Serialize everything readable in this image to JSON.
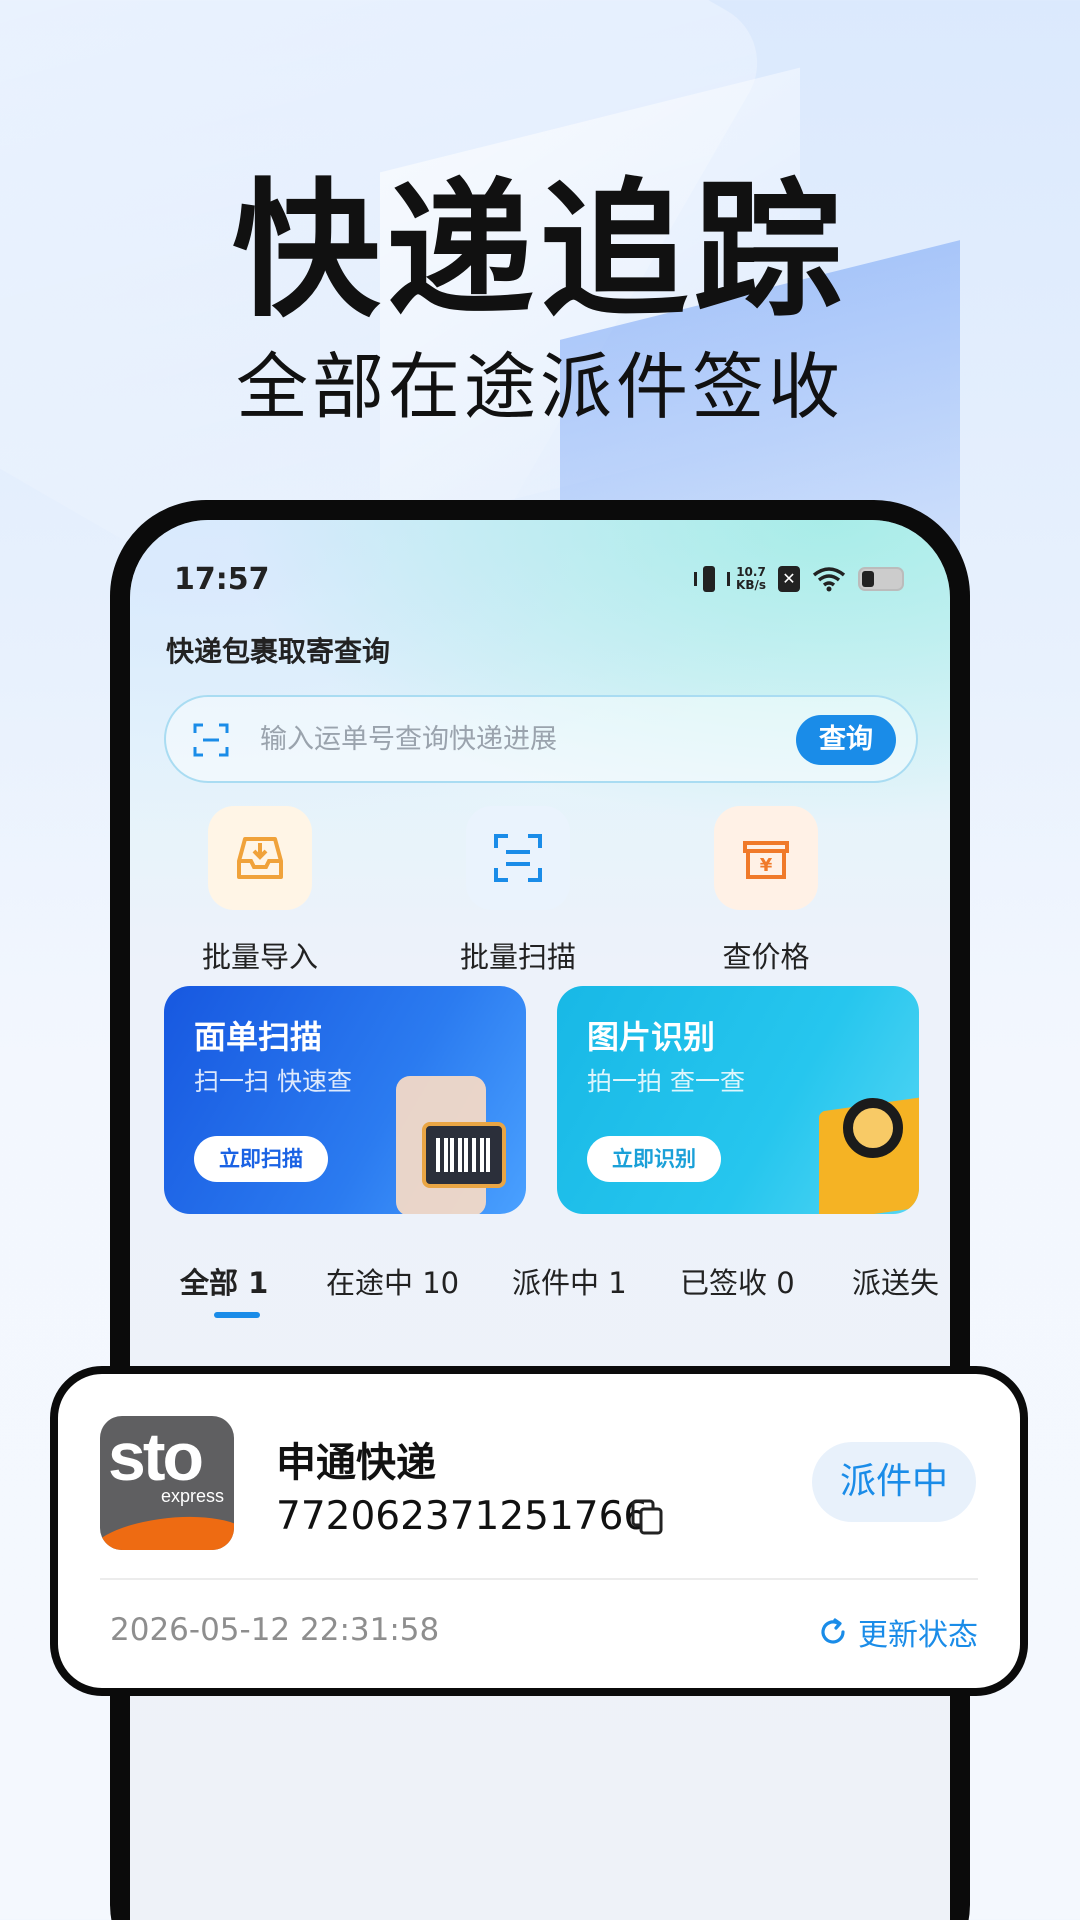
{
  "hero": {
    "title": "快递追踪",
    "subtitle": "全部在途派件签收"
  },
  "status_bar": {
    "time": "17:57",
    "net_speed_value": "10.7",
    "net_speed_unit": "KB/s"
  },
  "app": {
    "title": "快递包裹取寄查询"
  },
  "search": {
    "placeholder": "输入运单号查询快递进展",
    "button_label": "查询"
  },
  "quick_actions": [
    {
      "label": "批量导入",
      "icon": "inbox-download-icon",
      "color": "#f0a23a"
    },
    {
      "label": "批量扫描",
      "icon": "scan-icon",
      "color": "#1a8ce8"
    },
    {
      "label": "查价格",
      "icon": "price-box-icon",
      "color": "#f07a2a"
    }
  ],
  "banners": [
    {
      "title": "面单扫描",
      "subtitle": "扫一扫 快速查",
      "button_label": "立即扫描"
    },
    {
      "title": "图片识别",
      "subtitle": "拍一拍 查一查",
      "button_label": "立即识别"
    }
  ],
  "tabs": [
    {
      "label": "全部 1",
      "active": true
    },
    {
      "label": "在途中 10",
      "active": false
    },
    {
      "label": "派件中 1",
      "active": false
    },
    {
      "label": "已签收 0",
      "active": false
    },
    {
      "label": "派送失",
      "active": false
    }
  ],
  "shipment": {
    "logo_text": "sto",
    "logo_sub": "express",
    "carrier": "申通快递",
    "tracking_number": "772062371251766",
    "status": "派件中",
    "timestamp": "2026-05-12 22:31:58",
    "refresh_label": "更新状态"
  },
  "colors": {
    "accent": "#1a8ce8",
    "brand_orange": "#ee6b12"
  }
}
